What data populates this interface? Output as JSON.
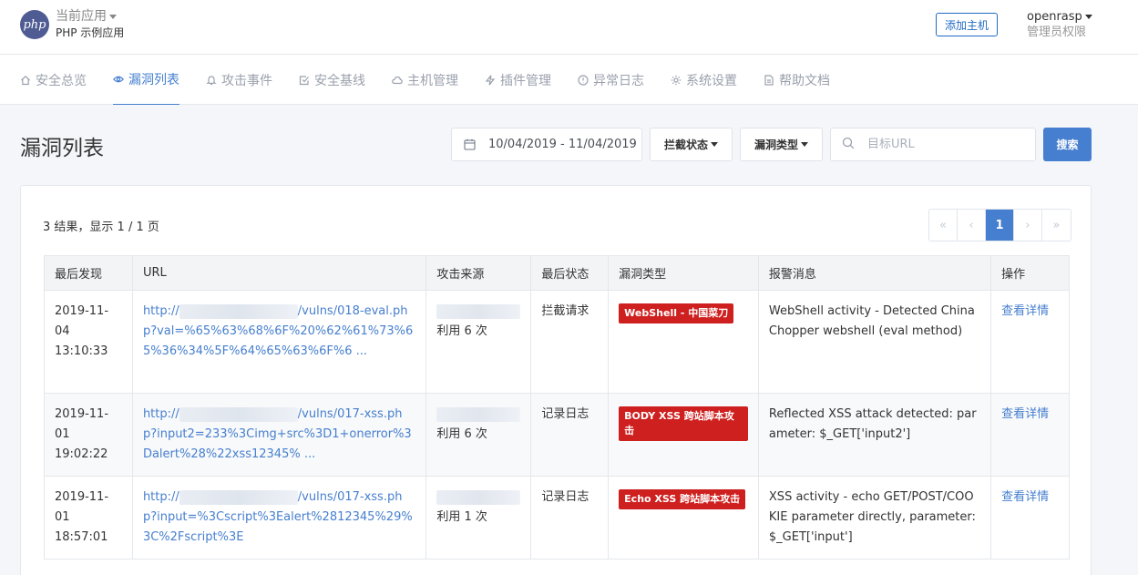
{
  "header": {
    "logo_text": "php",
    "app_label": "当前应用",
    "app_name": "PHP 示例应用",
    "add_host_label": "添加主机",
    "user_name": "openrasp",
    "user_role": "管理员权限"
  },
  "nav": {
    "items": [
      {
        "label": "安全总览",
        "icon": "home-icon"
      },
      {
        "label": "漏洞列表",
        "icon": "eye-icon",
        "active": true
      },
      {
        "label": "攻击事件",
        "icon": "bell-icon"
      },
      {
        "label": "安全基线",
        "icon": "check-square-icon"
      },
      {
        "label": "主机管理",
        "icon": "cloud-icon"
      },
      {
        "label": "插件管理",
        "icon": "zap-icon"
      },
      {
        "label": "异常日志",
        "icon": "alert-circle-icon"
      },
      {
        "label": "系统设置",
        "icon": "gear-icon"
      },
      {
        "label": "帮助文档",
        "icon": "file-icon"
      }
    ]
  },
  "page": {
    "title": "漏洞列表",
    "date_range": "10/04/2019 - 11/04/2019",
    "block_status_label": "拦截状态",
    "vuln_type_label": "漏洞类型",
    "url_placeholder": "目标URL",
    "search_label": "搜索"
  },
  "results": {
    "summary": "3 结果，显示 1 / 1 页",
    "pager": {
      "first": "«",
      "prev": "‹",
      "current": "1",
      "next": "›",
      "last": "»"
    }
  },
  "table": {
    "headers": [
      "最后发现",
      "URL",
      "攻击来源",
      "最后状态",
      "漏洞类型",
      "报警消息",
      "操作"
    ],
    "rows": [
      {
        "date": "2019-11-04",
        "time": "13:10:33",
        "url_prefix": "http://",
        "url_rest": "/vulns/018-eval.php?val=%65%63%68%6F%20%62%61%73%65%36%34%5F%64%65%63%6F%6 ...",
        "source_count": "利用 6 次",
        "status": "拦截请求",
        "type": "WebShell - 中国菜刀",
        "message": "WebShell activity - Detected China Chopper webshell (eval method)",
        "action": "查看详情"
      },
      {
        "date": "2019-11-01",
        "time": "19:02:22",
        "url_prefix": "http://",
        "url_rest": "/vulns/017-xss.php?input2=233%3Cimg+src%3D1+onerror%3Dalert%28%22xss12345% ...",
        "source_count": "利用 6 次",
        "status": "记录日志",
        "type": "BODY XSS 跨站脚本攻击",
        "message": "Reflected XSS attack detected: parameter: $_GET['input2']",
        "action": "查看详情"
      },
      {
        "date": "2019-11-01",
        "time": "18:57:01",
        "url_prefix": "http://",
        "url_rest": "/vulns/017-xss.php?input=%3Cscript%3Ealert%2812345%29%3C%2Fscript%3E",
        "source_count": "利用 1 次",
        "status": "记录日志",
        "type": "Echo XSS 跨站脚本攻击",
        "message": "XSS activity - echo GET/POST/COOKIE parameter directly, parameter: $_GET['input']",
        "action": "查看详情"
      }
    ]
  }
}
